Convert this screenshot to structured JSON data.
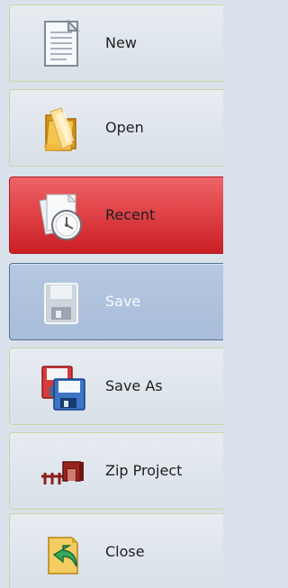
{
  "menu": {
    "items": [
      {
        "label": "New",
        "icon": "new-document-icon"
      },
      {
        "label": "Open",
        "icon": "open-folder-icon"
      },
      {
        "label": "Recent",
        "icon": "recent-documents-icon"
      },
      {
        "label": "Save",
        "icon": "save-icon"
      },
      {
        "label": "Save As",
        "icon": "save-as-icon"
      },
      {
        "label": "Zip Project",
        "icon": "zip-project-icon"
      },
      {
        "label": "Close",
        "icon": "close-project-icon"
      }
    ],
    "selected": "Save",
    "colors": {
      "panel": "#d9e2ea",
      "item": "#e2e8ee",
      "item_border": "#c8d6a6",
      "recent": "#d7353a",
      "save_selected": "#adc2dd"
    }
  }
}
